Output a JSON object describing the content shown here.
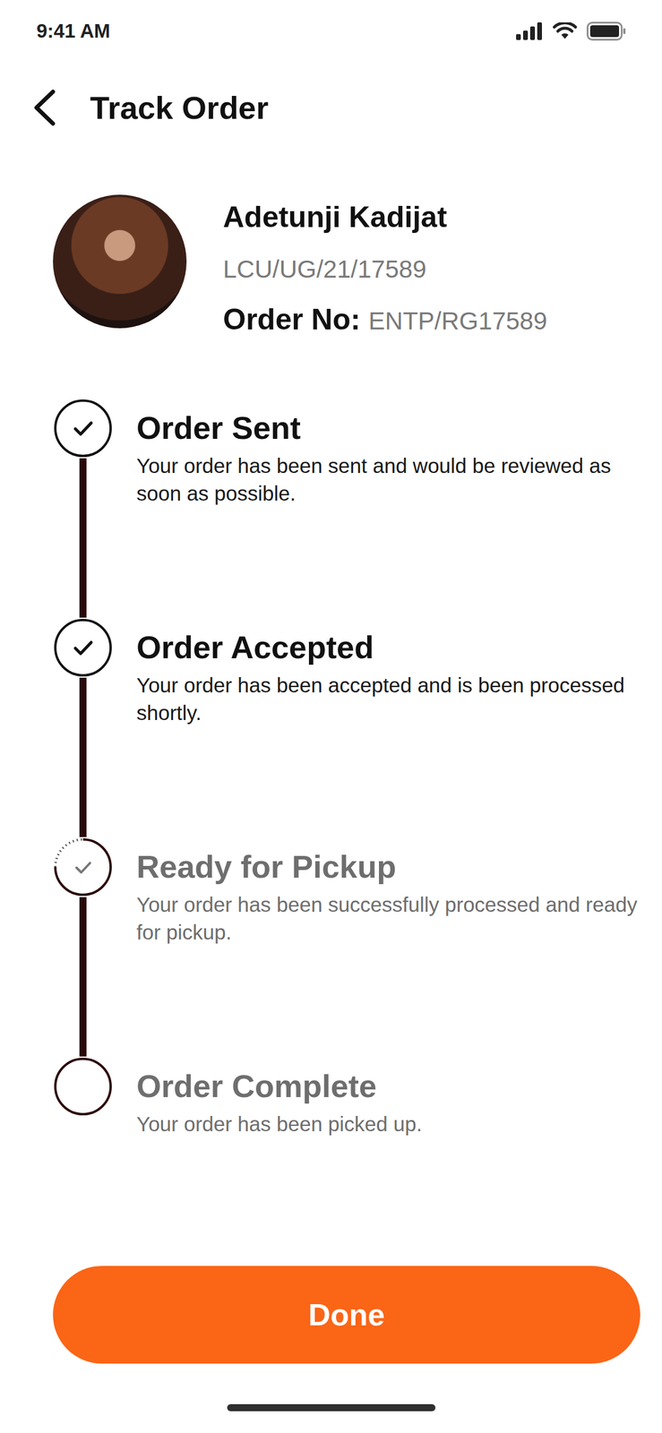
{
  "status_bar": {
    "time": "9:41 AM"
  },
  "header": {
    "title": "Track Order"
  },
  "profile": {
    "name": "Adetunji Kadijat",
    "id": "LCU/UG/21/17589",
    "order_label": "Order No:",
    "order_number": "ENTP/RG17589"
  },
  "steps": [
    {
      "title": "Order Sent",
      "description": "Your order has been sent and would be reviewed as soon as possible.",
      "done": true,
      "current": false
    },
    {
      "title": "Order Accepted",
      "description": "Your order has been accepted and is been processed shortly.",
      "done": true,
      "current": false
    },
    {
      "title": "Ready for Pickup",
      "description": "Your order has been successfully processed and ready for pickup.",
      "done": false,
      "current": true
    },
    {
      "title": "Order Complete",
      "description": "Your order has been picked up.",
      "done": false,
      "current": false
    }
  ],
  "buttons": [
    "Done"
  ]
}
